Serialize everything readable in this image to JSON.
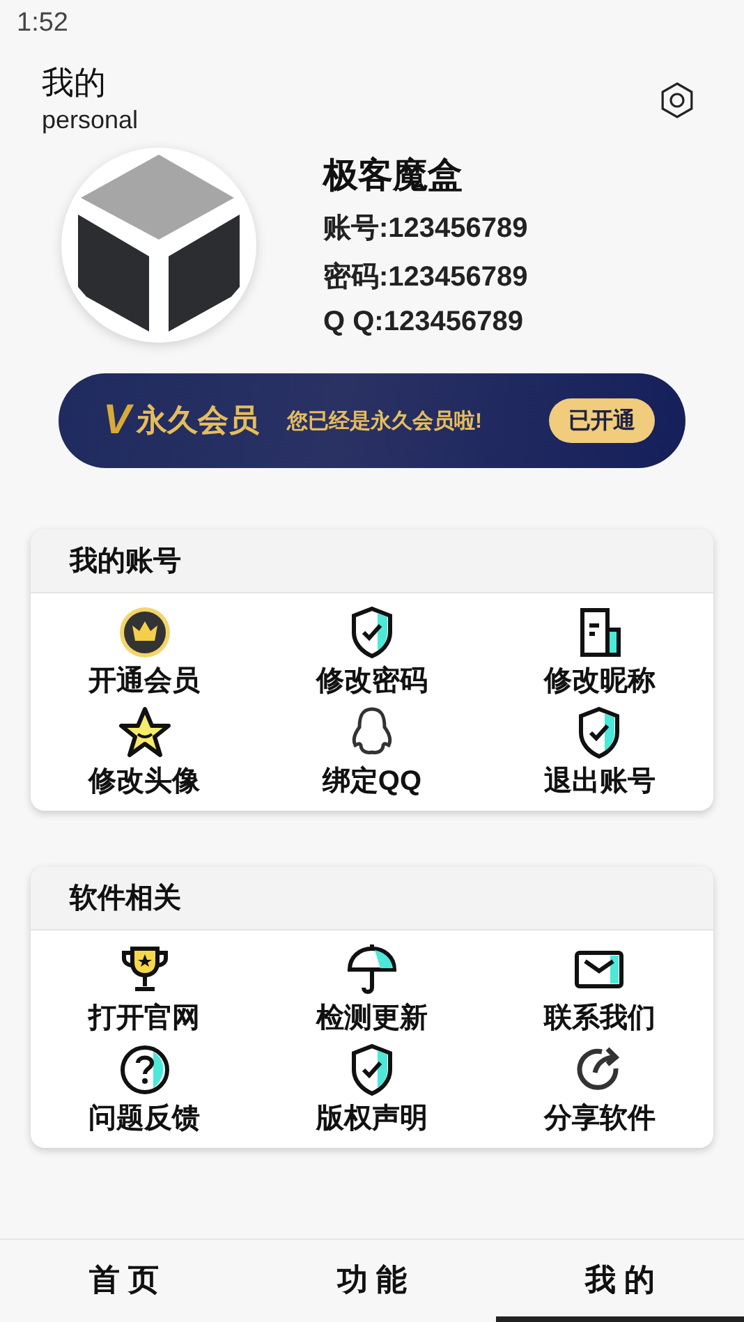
{
  "status_bar": {
    "time": "1:52"
  },
  "header": {
    "title": "我的",
    "subtitle": "personal"
  },
  "profile": {
    "name": "极客魔盒",
    "lines": [
      "账号:123456789",
      "密码:123456789",
      "Q Q:123456789"
    ]
  },
  "vip_banner": {
    "mark": "V",
    "title": "永久会员",
    "message": "您已经是永久会员啦!",
    "button": "已开通"
  },
  "sections": [
    {
      "title": "我的账号",
      "items": [
        {
          "label": "开通会员",
          "kind": "crown"
        },
        {
          "label": "修改密码",
          "kind": "shield"
        },
        {
          "label": "修改昵称",
          "kind": "document"
        },
        {
          "label": "修改头像",
          "kind": "star"
        },
        {
          "label": "绑定QQ",
          "kind": "penguin"
        },
        {
          "label": "退出账号",
          "kind": "shield"
        }
      ]
    },
    {
      "title": "软件相关",
      "items": [
        {
          "label": "打开官网",
          "kind": "trophy"
        },
        {
          "label": "检测更新",
          "kind": "umbrella"
        },
        {
          "label": "联系我们",
          "kind": "mail"
        },
        {
          "label": "问题反馈",
          "kind": "question"
        },
        {
          "label": "版权声明",
          "kind": "shield"
        },
        {
          "label": "分享软件",
          "kind": "share"
        }
      ]
    }
  ],
  "bottom_nav": [
    {
      "label": "首 页",
      "selected": false
    },
    {
      "label": "功 能",
      "selected": false
    },
    {
      "label": "我 的",
      "selected": true
    }
  ]
}
